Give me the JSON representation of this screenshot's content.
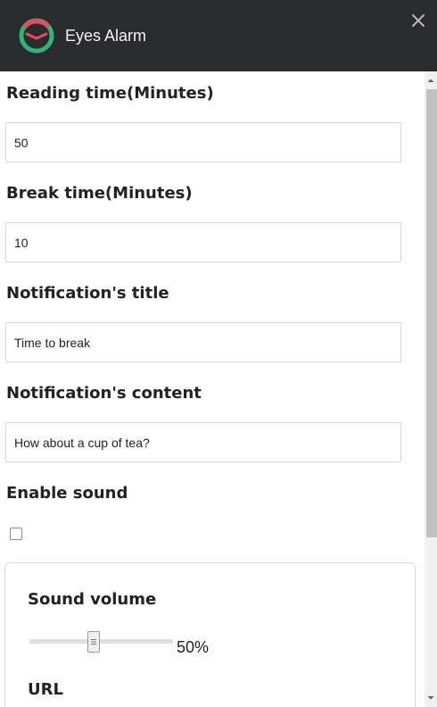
{
  "app": {
    "title": "Eyes Alarm",
    "logo_icon": "alarm-clock-ring-icon",
    "accent_colors": {
      "ring_green": "#2bb673",
      "ring_red": "#e84a5f",
      "titlebar": "#2a2b2e"
    }
  },
  "window": {
    "close_icon": "close-icon"
  },
  "form": {
    "reading_time": {
      "label": "Reading time(Minutes)",
      "value": "50"
    },
    "break_time": {
      "label": "Break time(Minutes)",
      "value": "10"
    },
    "notification_title": {
      "label": "Notification's title",
      "value": "Time to break"
    },
    "notification_content": {
      "label": "Notification's content",
      "value": "How about a cup of tea?"
    },
    "enable_sound": {
      "label": "Enable sound",
      "checked": false
    }
  },
  "sound_panel": {
    "volume_label": "Sound volume",
    "volume_percent": 50,
    "volume_display": "50%",
    "url_label": "URL"
  }
}
